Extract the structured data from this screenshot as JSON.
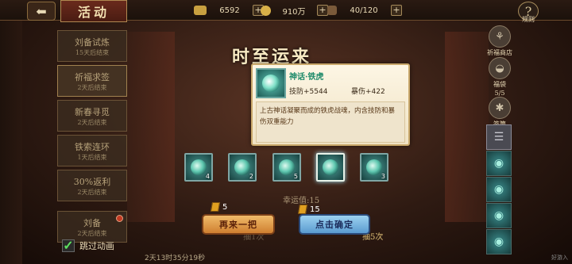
{
  "header": {
    "title": "活动",
    "resources": [
      {
        "icon": "gold-ingot-icon",
        "value": "6592"
      },
      {
        "icon": "coin-icon",
        "value": "910万"
      },
      {
        "icon": "stamina-icon",
        "value": "40/120"
      }
    ],
    "rules_label": "规则"
  },
  "sidebar": {
    "items": [
      {
        "name": "刘备试炼",
        "status": "15天后结束"
      },
      {
        "name": "祈福求签",
        "status": "2天后结束"
      },
      {
        "name": "新春寻觅",
        "status": "2天后结束"
      },
      {
        "name": "铁索连环",
        "status": "1天后结束"
      },
      {
        "name": "30%返利",
        "status": "2天后结束"
      },
      {
        "name": "刘备",
        "status": "2天后结束"
      }
    ]
  },
  "right_panel": {
    "items": [
      {
        "icon": "shop-icon",
        "label": "祈福商店"
      },
      {
        "icon": "lucky-bag-icon",
        "label": "福袋",
        "count": "5/5"
      },
      {
        "icon": "sign-icon",
        "label": "签筒"
      }
    ]
  },
  "main": {
    "banner": "时至运来",
    "luck_text": "幸运值:15",
    "slots": [
      {
        "count": "4",
        "selected": false
      },
      {
        "count": "2",
        "selected": false
      },
      {
        "count": "5",
        "selected": false
      },
      {
        "count": "",
        "selected": true
      },
      {
        "count": "3",
        "selected": false
      }
    ],
    "again_button": "再来一把",
    "confirm_button": "点击确定",
    "cost_left": "5",
    "cost_right": "15",
    "under_left": "抽1次",
    "under_right": "抽5次"
  },
  "tooltip": {
    "name": "神话·铁虎",
    "stat1": "技防+5544",
    "stat2": "暴伤+422",
    "description": "上古神话凝聚而成的铁虎战魂，内含技防和暴伤双重能力"
  },
  "footer": {
    "skip_label": "跳过动画",
    "skip_checked": true,
    "timer": "2天13时35分19秒",
    "watermark": "好游入"
  },
  "colors": {
    "accent_gold": "#f0bb6a",
    "accent_blue": "#9cd2f0",
    "item_teal": "#4c9a94"
  }
}
